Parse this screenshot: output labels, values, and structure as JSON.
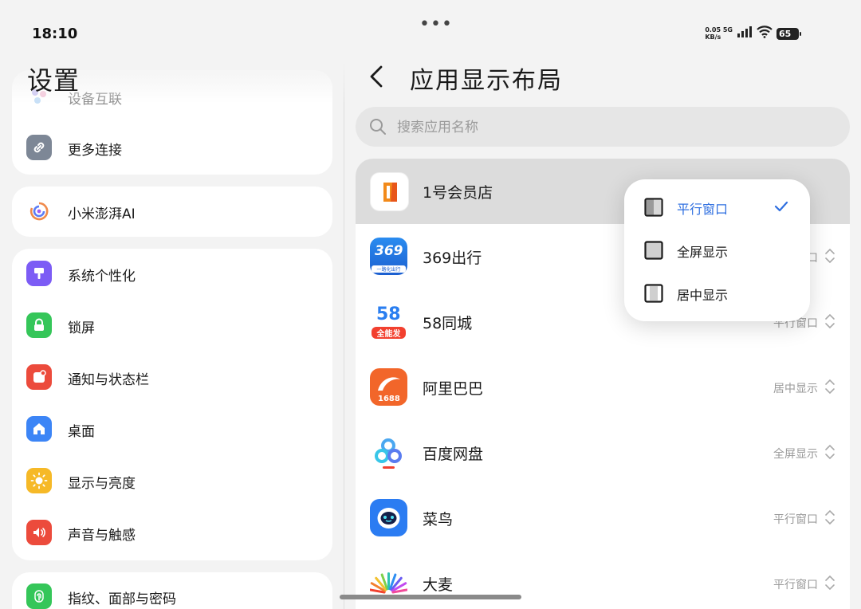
{
  "status": {
    "time": "18:10",
    "net_speed_value": "0.05",
    "net_speed_unit": "KB/s",
    "network": "5G",
    "battery": "65"
  },
  "left": {
    "title": "设置",
    "items": [
      {
        "label": "设备互联",
        "icon": "device-link-icon"
      },
      {
        "label": "更多连接",
        "icon": "link-icon",
        "color": "#7d8796"
      },
      {
        "label": "小米澎湃AI",
        "icon": "hyper-ai-icon"
      },
      {
        "label": "系统个性化",
        "icon": "brush-icon",
        "color": "#7c5cf5"
      },
      {
        "label": "锁屏",
        "icon": "lock-icon",
        "color": "#35c659"
      },
      {
        "label": "通知与状态栏",
        "icon": "notification-icon",
        "color": "#ec4b3c"
      },
      {
        "label": "桌面",
        "icon": "home-icon",
        "color": "#3c85f6"
      },
      {
        "label": "显示与亮度",
        "icon": "sun-icon",
        "color": "#f6b927"
      },
      {
        "label": "声音与触感",
        "icon": "speaker-icon",
        "color": "#ec4b3c"
      },
      {
        "label": "指纹、面部与密码",
        "icon": "fingerprint-icon",
        "color": "#35c659"
      }
    ]
  },
  "right": {
    "title": "应用显示布局",
    "search_placeholder": "搜索应用名称",
    "apps": [
      {
        "name": "1号会员店",
        "mode": "",
        "icon": "yihao-store-icon"
      },
      {
        "name": "369出行",
        "mode": "窗口",
        "icon": "369-travel-icon"
      },
      {
        "name": "58同城",
        "mode": "平行窗口",
        "icon": "58-tongcheng-icon"
      },
      {
        "name": "阿里巴巴",
        "mode": "居中显示",
        "icon": "alibaba-1688-icon"
      },
      {
        "name": "百度网盘",
        "mode": "全屏显示",
        "icon": "baidu-netdisk-icon"
      },
      {
        "name": "菜鸟",
        "mode": "平行窗口",
        "icon": "cainiao-icon"
      },
      {
        "name": "大麦",
        "mode": "平行窗口",
        "icon": "damai-icon"
      }
    ],
    "icon_text": {
      "app_369_badge": "369",
      "app_369_sub": "一路化出行",
      "app_58_num": "58",
      "app_58_sub": "全能发",
      "app_1688": "1688"
    }
  },
  "popup": {
    "options": [
      {
        "label": "平行窗口",
        "selected": true,
        "icon": "parallel-window-icon"
      },
      {
        "label": "全屏显示",
        "selected": false,
        "icon": "fullscreen-icon"
      },
      {
        "label": "居中显示",
        "selected": false,
        "icon": "center-display-icon"
      }
    ],
    "accent": "#2f6fe0"
  }
}
